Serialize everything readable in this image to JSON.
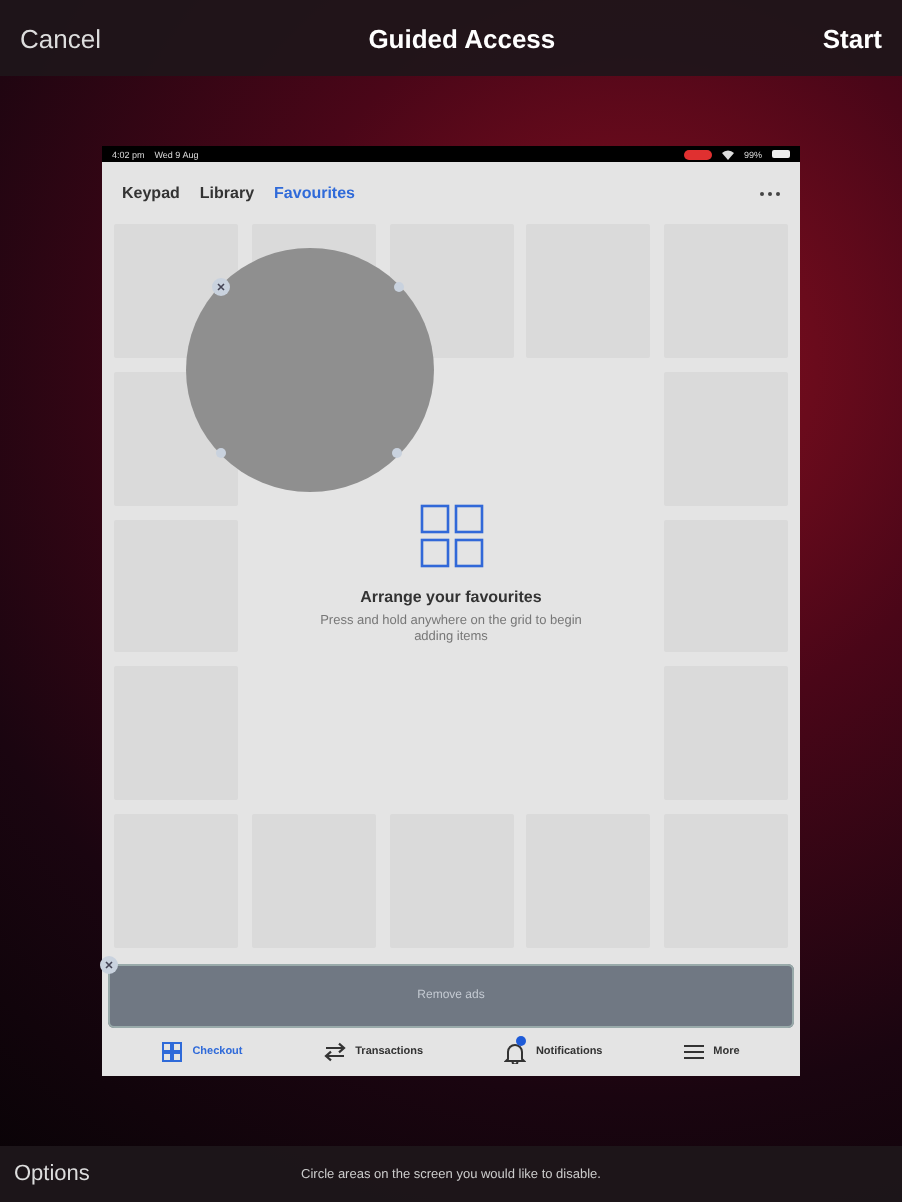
{
  "top_bar": {
    "cancel": "Cancel",
    "title": "Guided Access",
    "start": "Start"
  },
  "device": {
    "status_bar": {
      "time": "4:02 pm",
      "date": "Wed 9 Aug",
      "battery": "99%"
    },
    "tabs": [
      {
        "label": "Keypad",
        "selected": false
      },
      {
        "label": "Library",
        "selected": false
      },
      {
        "label": "Favourites",
        "selected": true
      }
    ],
    "empty_state": {
      "title": "Arrange your favourites",
      "message": "Press and hold anywhere on the grid to begin adding items"
    },
    "ad_banner": {
      "label": "Remove ads"
    },
    "nav": [
      {
        "kind": "grid",
        "label": "Checkout",
        "selected": true
      },
      {
        "kind": "transfer",
        "label": "Transactions",
        "selected": false
      },
      {
        "kind": "bell",
        "label": "Notifications",
        "selected": false,
        "badge": true
      },
      {
        "kind": "menu",
        "label": "More",
        "selected": false
      }
    ]
  },
  "bottom_bar": {
    "options": "Options",
    "hint": "Circle areas on the screen you would like to disable."
  }
}
